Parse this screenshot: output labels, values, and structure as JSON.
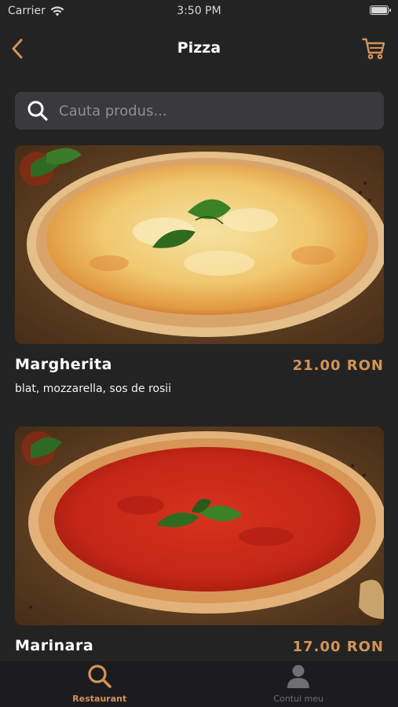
{
  "status_bar": {
    "carrier": "Carrier",
    "time": "3:50 PM"
  },
  "header": {
    "title": "Pizza",
    "back_icon": "chevron-left-icon",
    "cart_icon": "cart-icon"
  },
  "search": {
    "placeholder": "Cauta produs...",
    "value": ""
  },
  "products": [
    {
      "name": "Margherita",
      "price": "21.00  RON",
      "description": "blat, mozzarella, sos de rosii"
    },
    {
      "name": "Marinara",
      "price": "17.00  RON",
      "description": ""
    }
  ],
  "tab_bar": {
    "tabs": [
      {
        "label": "Restaurant",
        "icon": "search-icon",
        "active": true
      },
      {
        "label": "Contul meu",
        "icon": "user-icon",
        "active": false
      }
    ]
  },
  "colors": {
    "accent": "#d3935a",
    "background": "#232323",
    "search_bg": "#3a3a3c",
    "tab_bar_bg": "#1c1c1e"
  }
}
